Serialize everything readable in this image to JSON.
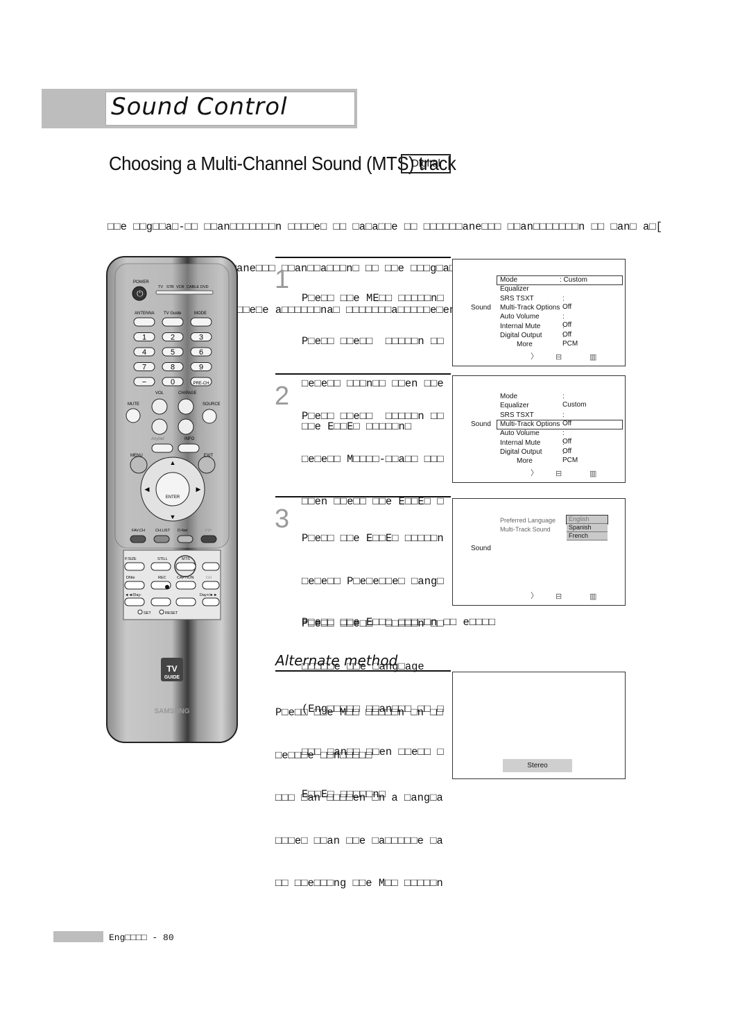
{
  "header": {
    "section_title": "Sound Control"
  },
  "page_title": "Choosing a Multi-Channel Sound (MTS) track",
  "title_badge": "Digital",
  "intro": [
    "□□e □□g□□a□-□□ □□an□□□□□□□n □□□□e□ □□ □a□a□□e □□ □□□□□□ane□□□ □□an□□□□□□□n □□ □an□ a□[",
    "(□□□ e□a□□□e□ □□□□□□ane□□□ □□an□□a□□□n□ □□ □□e □□□g□a□ □n□□ □□□e□gn □ang□age□)□",
    "□□e a□a□□a□□□□□□ □□ □□e□e a□□□□□□na□ □□□□□□□a□□□□□e□en□□ □□□n □□e □□□g□a□□"
  ],
  "steps": [
    {
      "number": "1",
      "lines": [
        "P□e□□ □□e ME□□ □□□□□n□",
        "P□e□□ □□e□□  □□□□□n □□",
        "□e□e□□ □□□n□□ □□en □□e",
        "□□e E□□E□ □□□□□n□"
      ]
    },
    {
      "number": "2",
      "lines": [
        "P□e□□ □□e□□  □□□□□n □□",
        "□e□e□□ M□□□□-□□a□□ □□□",
        "□□en □□e□□ □□e E□□E□ □"
      ]
    },
    {
      "number": "3",
      "lines": [
        "P□e□□ □□e E□□E□ □□□□□n",
        "□e□e□□ P□e□e□□e□ □ang□",
        "P□e□□ □□e□□  □□□□□n □□",
        "□□□□□e □□e □ang□age",
        "(Eng□□□□□ □□an□□□ □□ □",
        "□□□ □an□□ □□en □□e□□ □",
        "E□□E□ □□□□□n□"
      ]
    }
  ],
  "exit_note": "P□e□□ □□e E□□□ □□□□□n □□ e□□□□",
  "alternate": {
    "heading": "Alternate method",
    "lines": [
      "P□e□□ □□e M□□ □□□□□n □n □□",
      "□e□□□e □□n□□□□□",
      "□□□ □an □□□□en □n a □ang□a",
      "□□□e□ □□an □□e □a□□□□□e □a",
      "□□ □□e□□□ng □□e M□□ □□□□□n"
    ]
  },
  "osd_menu": {
    "side_label": "Sound",
    "items": [
      {
        "label": "Mode",
        "value": ": Custom"
      },
      {
        "label": "Equalizer",
        "value": ""
      },
      {
        "label": "SRS TSXT",
        "value": ": Off"
      },
      {
        "label": "Multi-Track Options",
        "value": ""
      },
      {
        "label": "Auto Volume",
        "value": ": Off"
      },
      {
        "label": "Internal Mute",
        "value": ": Off"
      },
      {
        "label": "Digital Output",
        "value": ": PCM"
      },
      {
        "label": "More",
        "value": ""
      }
    ],
    "screen1_selected": "Mode",
    "screen2_selected": "Multi-Track Options",
    "footer_icons": [
      "move-icon",
      "enter-icon",
      "return-icon"
    ]
  },
  "osd_mts": {
    "side_label": "Sound",
    "items": [
      "Preferred Language",
      "Multi-Track Sound"
    ],
    "languages": [
      "English",
      "Spanish",
      "French"
    ],
    "selected_language": "English"
  },
  "osd_stereo": {
    "label": "Stereo"
  },
  "remote": {
    "power": "POWER",
    "modes": [
      "TV",
      "STB",
      "VCR",
      "CABLE",
      "DVD"
    ],
    "top_row": [
      "ANTENNA",
      "TV Guide",
      "MODE"
    ],
    "digits": [
      "1",
      "2",
      "3",
      "4",
      "5",
      "6",
      "7",
      "8",
      "9",
      "−",
      "0",
      "PRE-CH"
    ],
    "vol": "VOL",
    "ch": "CH/PAGE",
    "mute": "MUTE",
    "source": "SOURCE",
    "anynet": "Anynet",
    "info": "INFO",
    "menu": "MENU",
    "exit": "EXIT",
    "enter": "ENTER",
    "color_row": [
      "FAV.CH",
      "CH.LIST",
      "D-Net",
      "PIP"
    ],
    "row1": [
      "P.SIZE",
      "STILL",
      "MTS"
    ],
    "row2": [
      "DNIe",
      "REC",
      "CAPTION",
      "CH"
    ],
    "row3": [
      "◄◄/Day-",
      "Day+/►►"
    ],
    "set": "SET",
    "reset": "RESET",
    "tvguide_logo": "TV GUIDE",
    "brand": "SAMSUNG"
  },
  "footer": {
    "page_label": "Eng□□□□ - 80"
  },
  "colors": {
    "band": "#bdbdbd",
    "remote_body": "#a9a9a9",
    "step_number": "#9a9a9a"
  }
}
